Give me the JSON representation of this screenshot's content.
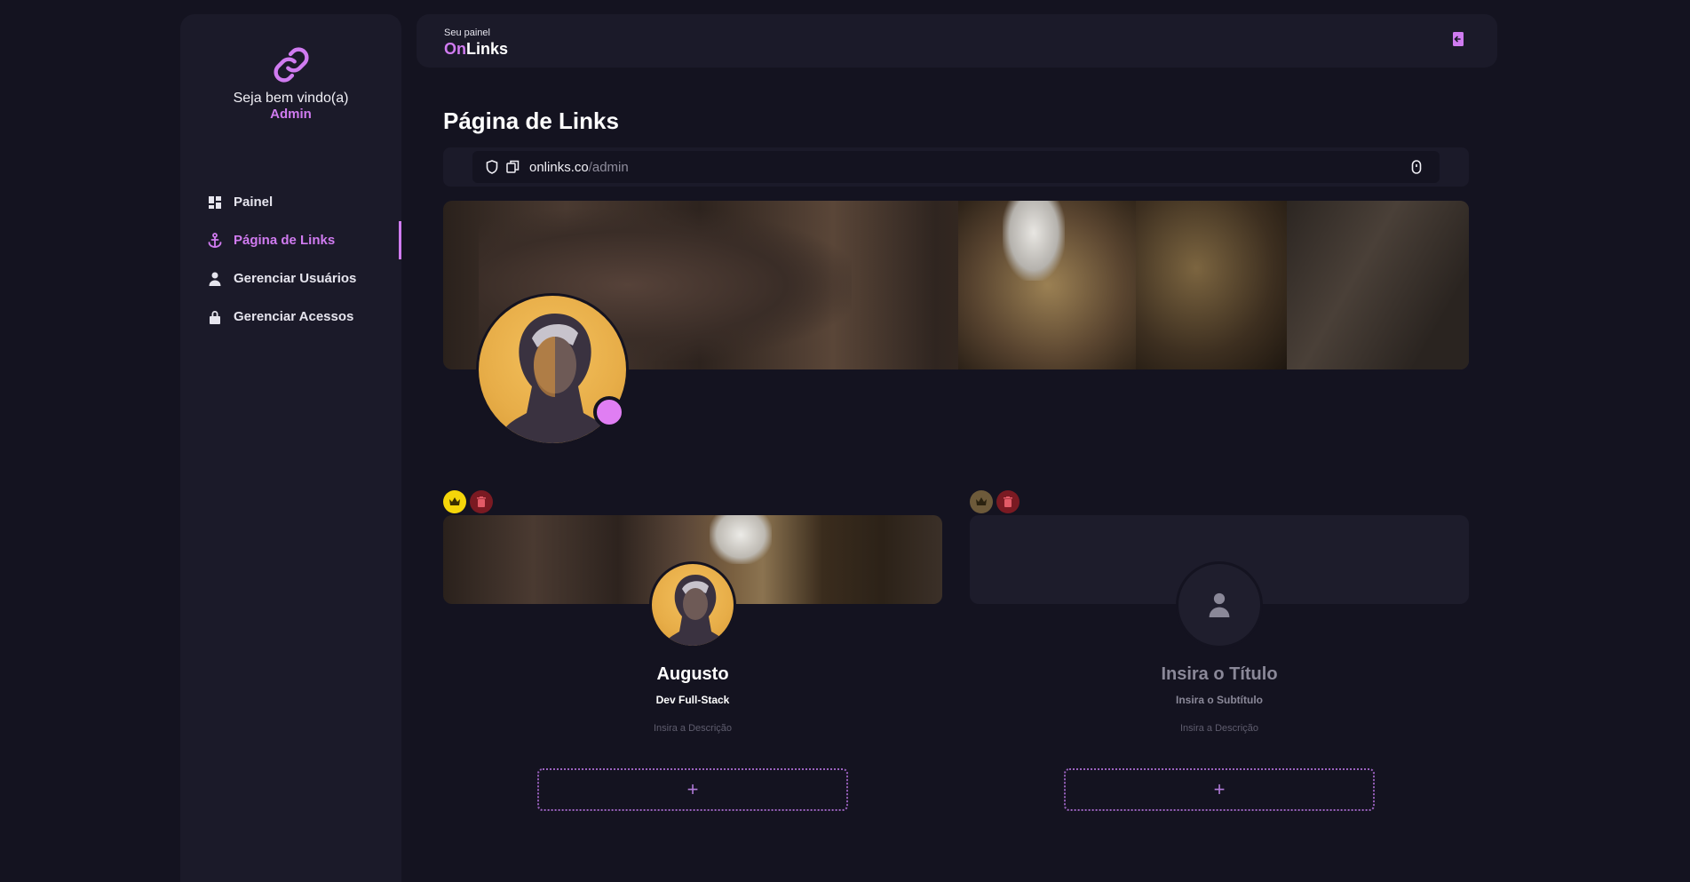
{
  "sidebar": {
    "logo_icon": "link-icon",
    "welcome_text": "Seja bem vindo(a)",
    "user_name": "Admin",
    "items": [
      {
        "label": "Painel",
        "icon": "dashboard-icon",
        "active": false
      },
      {
        "label": "Página de Links",
        "icon": "anchor-icon",
        "active": true
      },
      {
        "label": "Gerenciar Usuários",
        "icon": "user-icon",
        "active": false
      },
      {
        "label": "Gerenciar Acessos",
        "icon": "lock-icon",
        "active": false
      }
    ]
  },
  "topbar": {
    "subtitle": "Seu painel",
    "brand_on": "On",
    "brand_links": "Links",
    "logout_icon": "logout-icon"
  },
  "main": {
    "title": "Página de Links",
    "url": {
      "domain": "onlinks.co",
      "slash": "/",
      "path": "admin"
    }
  },
  "cards": [
    {
      "title": "Augusto",
      "subtitle": "Dev Full-Stack",
      "description": "Insira a Descrição",
      "add_label": "+",
      "crown_color": "#f5d60a",
      "trash_color": "#7a1a22"
    },
    {
      "title": "Insira o Título",
      "subtitle": "Insira o Subtítulo",
      "description": "Insira a Descrição",
      "add_label": "+",
      "crown_color": "#6d5a3a",
      "trash_color": "#7a1a22"
    }
  ],
  "colors": {
    "accent": "#d07bf0",
    "background": "#141320",
    "panel": "#1b1a29"
  }
}
